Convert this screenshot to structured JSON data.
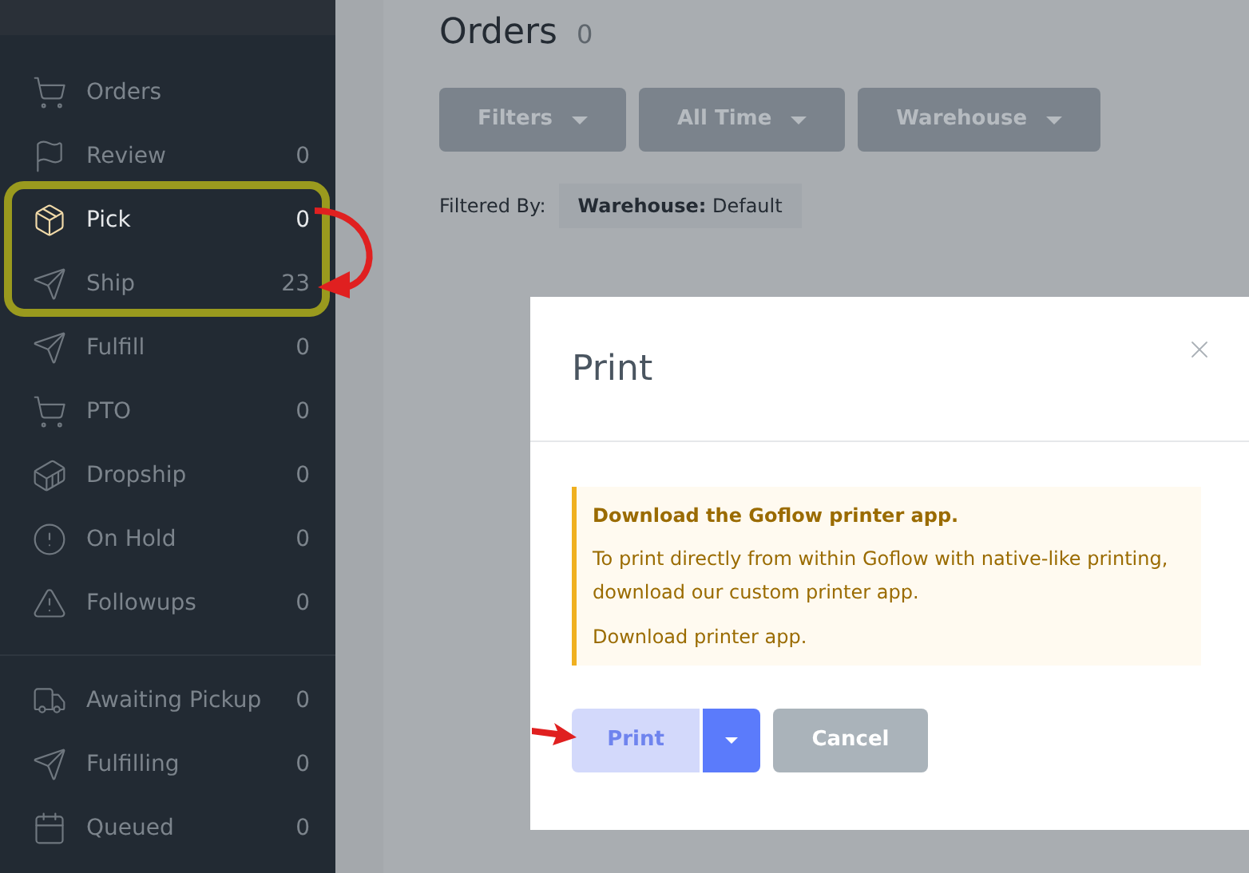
{
  "sidebar": {
    "groups": [
      [
        {
          "label": "Orders",
          "selected": false
        },
        {
          "label": "Review",
          "count": "0",
          "selected": false
        },
        {
          "label": "Pick",
          "count": "0",
          "selected": true
        },
        {
          "label": "Ship",
          "count": "23",
          "selected": false
        },
        {
          "label": "Fulfill",
          "count": "0",
          "selected": false
        },
        {
          "label": "PTO",
          "count": "0",
          "selected": false
        },
        {
          "label": "Dropship",
          "count": "0",
          "selected": false
        },
        {
          "label": "On Hold",
          "count": "0",
          "selected": false
        },
        {
          "label": "Followups",
          "count": "0",
          "selected": false
        }
      ],
      [
        {
          "label": "Awaiting Pickup",
          "count": "0",
          "selected": false
        },
        {
          "label": "Fulfilling",
          "count": "0",
          "selected": false
        },
        {
          "label": "Queued",
          "count": "0",
          "selected": false
        }
      ]
    ]
  },
  "page": {
    "title": "Orders",
    "count": "0",
    "filters": [
      "Filters",
      "All Time",
      "Warehouse"
    ],
    "filtered_by_label": "Filtered By:",
    "filter_chip": "**Warehouse:** Default"
  },
  "dialog": {
    "title": "Print",
    "alert": {
      "title": "Download the Goflow printer app.",
      "body": "To print directly from within Goflow with native-like printing, download our custom printer app.",
      "link": "Download printer app."
    },
    "buttons": [
      {
        "label": "Print",
        "kind": "primary",
        "disabled": true
      },
      {
        "label": "Cancel",
        "kind": "secondary",
        "disabled": false
      }
    ]
  }
}
